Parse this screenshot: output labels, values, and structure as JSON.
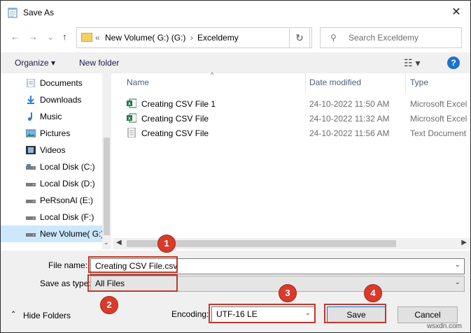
{
  "window": {
    "title": "Save As",
    "close_glyph": "✕"
  },
  "nav": {
    "back": "←",
    "forward": "→",
    "up": "↑",
    "address_prefix": "«",
    "address_parts": [
      "New Volume( G:) (G:)",
      "›",
      "Exceldemy"
    ],
    "address_chevron": "⌄",
    "refresh": "↻",
    "search_placeholder": "Search Exceldemy"
  },
  "toolbar": {
    "organize": "Organize ▾",
    "new_folder": "New folder",
    "help": "?"
  },
  "sidebar": {
    "items": [
      {
        "label": "Documents",
        "icon": "documents-icon"
      },
      {
        "label": "Downloads",
        "icon": "downloads-icon"
      },
      {
        "label": "Music",
        "icon": "music-icon"
      },
      {
        "label": "Pictures",
        "icon": "pictures-icon"
      },
      {
        "label": "Videos",
        "icon": "videos-icon"
      },
      {
        "label": "Local Disk (C:)",
        "icon": "drive-icon"
      },
      {
        "label": "Local Disk (D:)",
        "icon": "drive-icon"
      },
      {
        "label": "PeRsonAl (E:)",
        "icon": "drive-icon"
      },
      {
        "label": "Local Disk (F:)",
        "icon": "drive-icon"
      },
      {
        "label": "New Volume( G:)",
        "icon": "drive-icon",
        "selected": true
      }
    ]
  },
  "files": {
    "columns": [
      "Name",
      "Date modified",
      "Type"
    ],
    "rows": [
      {
        "name": "Creating CSV File 1",
        "date": "24-10-2022 11:50 AM",
        "type": "Microsoft Excel",
        "icon": "excel-file-icon"
      },
      {
        "name": "Creating CSV File",
        "date": "24-10-2022 11:32 AM",
        "type": "Microsoft Excel",
        "icon": "excel-file-icon"
      },
      {
        "name": "Creating CSV File",
        "date": "24-10-2022 11:56 AM",
        "type": "Text Document",
        "icon": "text-file-icon"
      }
    ]
  },
  "form": {
    "file_name_label": "File name:",
    "file_name_value": "Creating CSV File.csv",
    "save_type_label": "Save as type:",
    "save_type_value": "All Files",
    "encoding_label": "Encoding:",
    "encoding_value": "UTF-16 LE",
    "save_button": "Save",
    "cancel_button": "Cancel",
    "hide_folders": "Hide Folders",
    "hide_folders_caret": "⌃"
  },
  "annotations": [
    "1",
    "2",
    "3",
    "4"
  ],
  "watermark": "wsxdn.com",
  "colors": {
    "highlight": "#c0392b",
    "badge": "#d93a2b",
    "selection": "#cce8ff",
    "accent": "#0078d7"
  }
}
